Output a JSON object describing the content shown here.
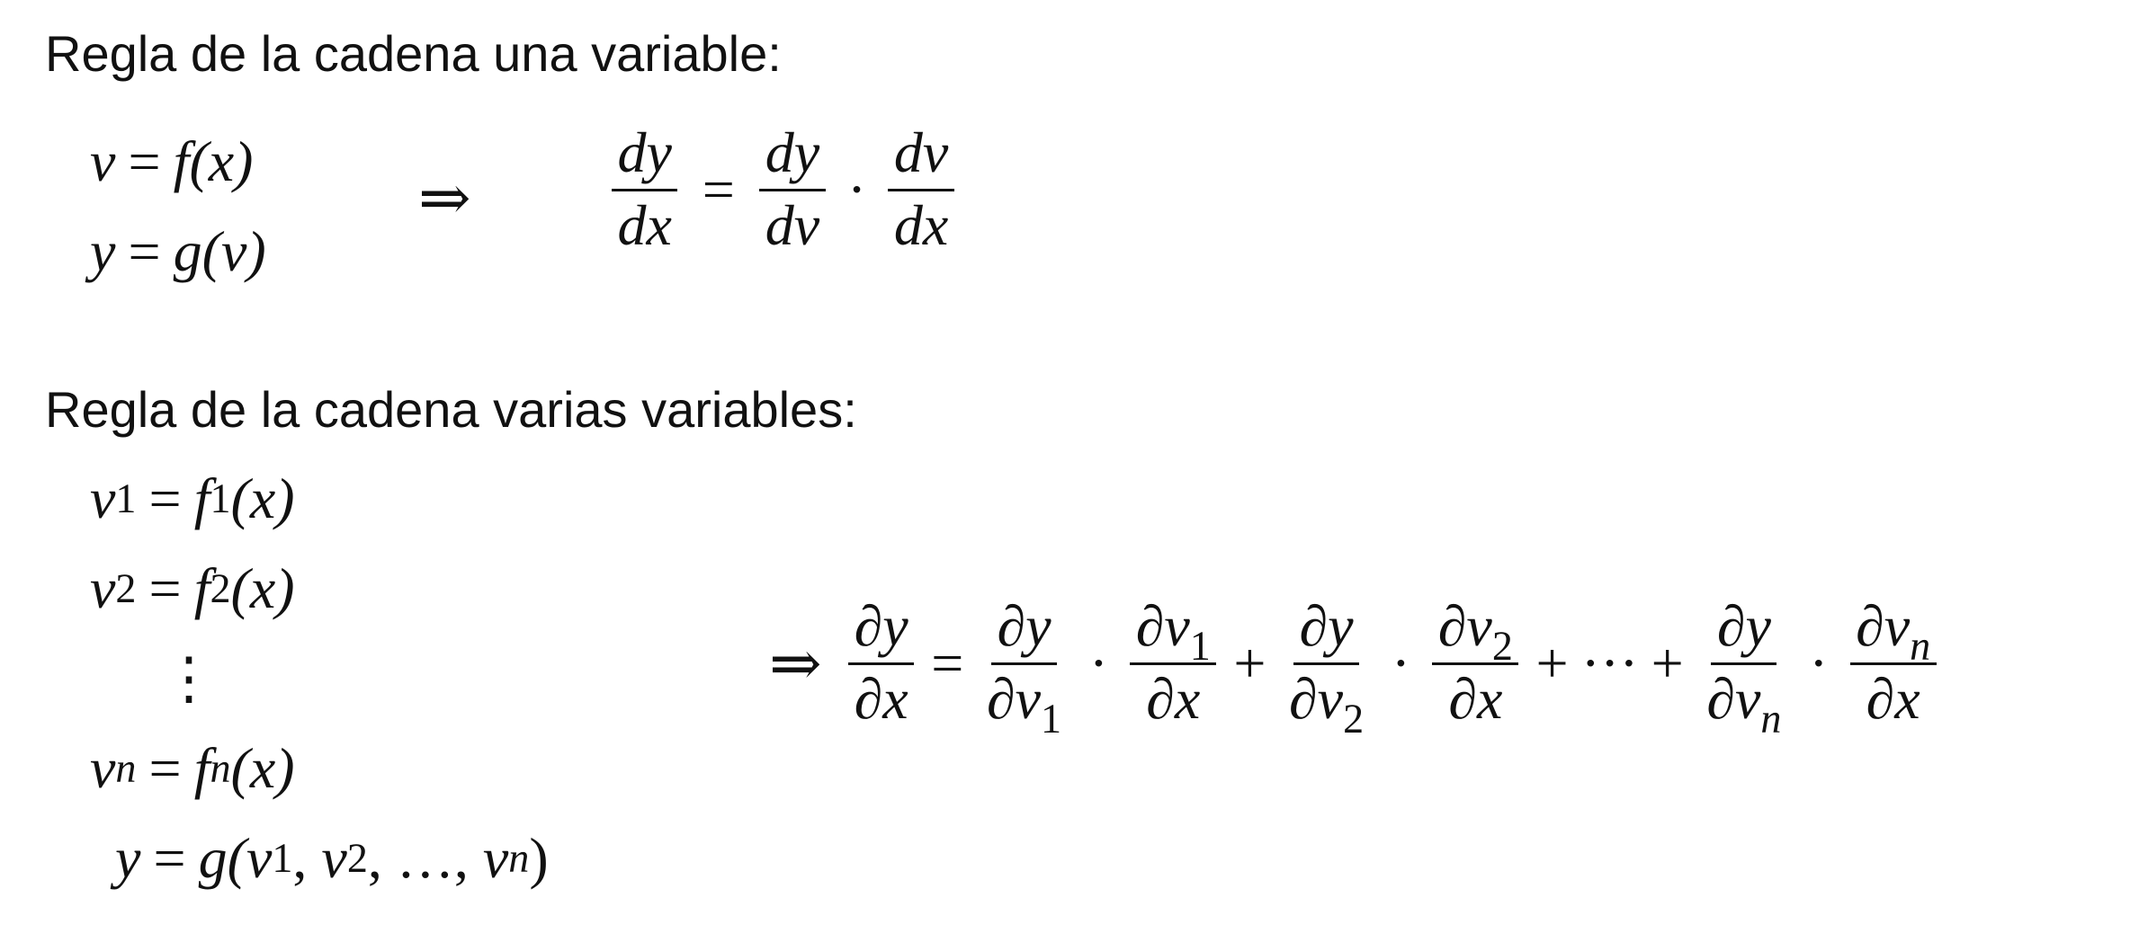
{
  "section_single": {
    "heading": "Regla de la cadena una variable:",
    "def1": {
      "lhs": "v",
      "eq": "=",
      "rhs": "f(x)"
    },
    "def2": {
      "lhs": "y",
      "eq": "=",
      "rhs": "g(v)"
    },
    "implies": "⇒",
    "formula": {
      "lhs_num": "dy",
      "lhs_den": "dx",
      "eq": "=",
      "f1_num": "dy",
      "f1_den": "dv",
      "times": "·",
      "f2_num": "dv",
      "f2_den": "dx"
    }
  },
  "section_multi": {
    "heading": "Regla de la cadena varias variables:",
    "defs": {
      "v": "v",
      "f": "f",
      "x": "(x)",
      "eq": "=",
      "sub1": "1",
      "sub2": "2",
      "subn": "n",
      "vdots": "⋮",
      "y": "y",
      "g_open": "g(",
      "sep": ",",
      "ellipsis": "…",
      "close": ")"
    },
    "implies": "⇒",
    "formula": {
      "partial": "∂",
      "y": "y",
      "x": "x",
      "v": "v",
      "eq": "=",
      "times": "·",
      "plus": "+",
      "cdots": "···",
      "sub1": "1",
      "sub2": "2",
      "subn": "n"
    }
  }
}
